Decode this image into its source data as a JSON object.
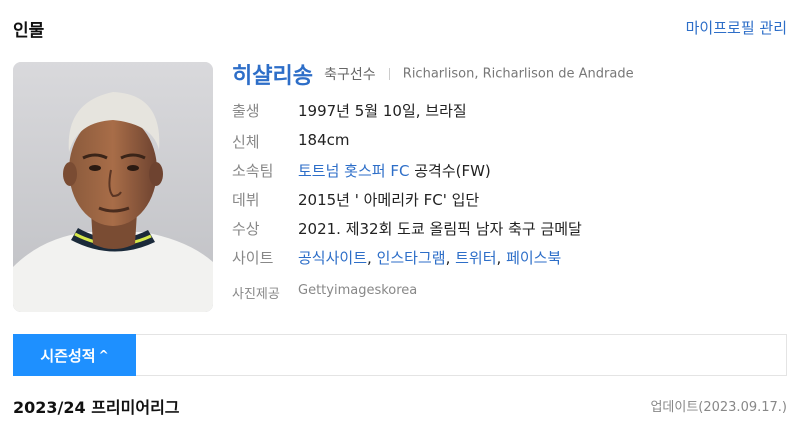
{
  "section": {
    "title": "인물",
    "profile_link": "마이프로필 관리"
  },
  "person": {
    "name": "히샬리송",
    "role": "축구선수",
    "alt_names": "Richarlison, Richarlison de Andrade"
  },
  "info": {
    "birth": {
      "label": "출생",
      "value": "1997년 5월 10일, 브라질"
    },
    "height": {
      "label": "신체",
      "value": "184cm"
    },
    "team": {
      "label": "소속팀",
      "team_name": "토트넘 홋스퍼 FC",
      "position": " 공격수(FW)"
    },
    "debut": {
      "label": "데뷔",
      "value": "2015년 ' 아메리카 FC' 입단"
    },
    "award": {
      "label": "수상",
      "value": "2021. 제32회 도쿄 올림픽 남자 축구 금메달"
    },
    "sites": {
      "label": "사이트",
      "links": [
        "공식사이트",
        "인스타그램",
        "트위터",
        "페이스북"
      ],
      "separator": ", "
    },
    "photo_credit": {
      "label": "사진제공",
      "value": "Gettyimageskorea"
    }
  },
  "tabs": {
    "season_label": "시즌성적",
    "season_chevron": "^"
  },
  "league": {
    "title": "2023/24 프리미어리그",
    "updated": "업데이트(2023.09.17.)"
  }
}
